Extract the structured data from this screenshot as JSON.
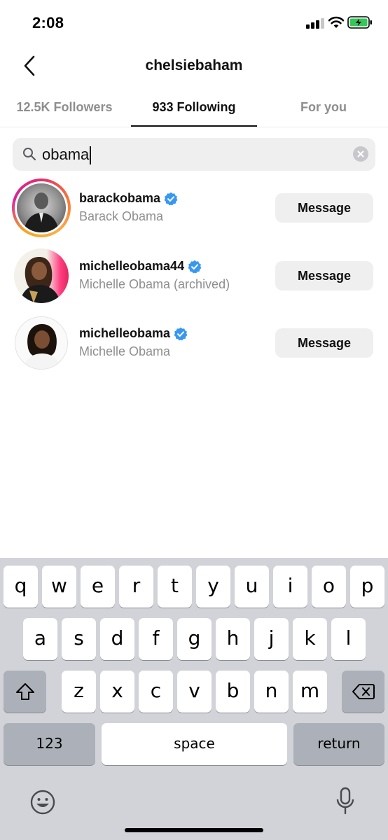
{
  "status_bar": {
    "time": "2:08",
    "signal_bars_filled": 3,
    "signal_bars_total": 4,
    "battery_charging": true,
    "icons": [
      "signal-icon",
      "wifi-icon",
      "battery-icon"
    ]
  },
  "header": {
    "title": "chelsiebaham",
    "back_icon": "chevron-left-icon"
  },
  "tabs": [
    {
      "label": "12.5K Followers",
      "active": false
    },
    {
      "label": "933 Following",
      "active": true
    },
    {
      "label": "For you",
      "active": false
    }
  ],
  "search": {
    "value": "obama",
    "search_icon": "search-icon",
    "clear_icon": "clear-icon"
  },
  "results": [
    {
      "username": "barackobama",
      "full_name": "Barack Obama",
      "verified": true,
      "story_ring": true,
      "button_label": "Message"
    },
    {
      "username": "michelleobama44",
      "full_name": "Michelle Obama (archived)",
      "verified": true,
      "story_ring": false,
      "button_label": "Message"
    },
    {
      "username": "michelleobama",
      "full_name": "Michelle Obama",
      "verified": true,
      "story_ring": false,
      "button_label": "Message"
    }
  ],
  "keyboard": {
    "row1": [
      "q",
      "w",
      "e",
      "r",
      "t",
      "y",
      "u",
      "i",
      "o",
      "p"
    ],
    "row2": [
      "a",
      "s",
      "d",
      "f",
      "g",
      "h",
      "j",
      "k",
      "l"
    ],
    "row3": [
      "z",
      "x",
      "c",
      "v",
      "b",
      "n",
      "m"
    ],
    "numbers_label": "123",
    "space_label": "space",
    "return_label": "return",
    "icons": [
      "shift-icon",
      "delete-icon",
      "emoji-icon",
      "microphone-icon"
    ]
  },
  "colors": {
    "verified_blue": "#3897f0",
    "secondary_text": "#8e8e8e",
    "button_bg": "#efeff0",
    "keyboard_bg": "#d1d3d9",
    "battery_green": "#34c759"
  }
}
